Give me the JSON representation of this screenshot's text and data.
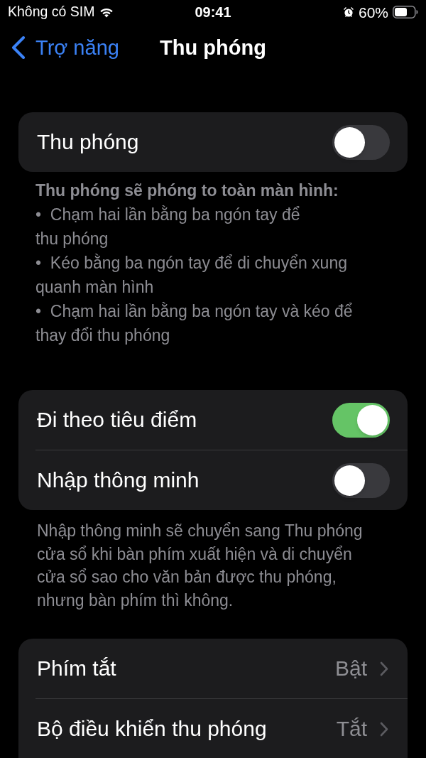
{
  "status_bar": {
    "carrier": "Không có SIM",
    "time": "09:41",
    "battery_percent": "60%"
  },
  "nav": {
    "back_label": "Trợ năng",
    "title": "Thu phóng"
  },
  "sections": [
    {
      "rows": [
        {
          "kind": "switch",
          "label": "Thu phóng",
          "on": false
        }
      ],
      "footer": {
        "heading": "Thu phóng sẽ phóng to toàn màn hình:",
        "bullets": [
          "•  Chạm hai lần bằng ba ngón tay để thu phóng",
          "•  Kéo bằng ba ngón tay để di chuyển xung quanh màn hình",
          "•  Chạm hai lần bằng ba ngón tay và kéo để thay đổi thu phóng"
        ]
      }
    },
    {
      "rows": [
        {
          "kind": "switch",
          "label": "Đi theo tiêu điểm",
          "on": true
        },
        {
          "kind": "switch",
          "label": "Nhập thông minh",
          "on": false
        }
      ],
      "footer": {
        "text": "Nhập thông minh sẽ chuyển sang Thu phóng cửa sổ khi bàn phím xuất hiện và di chuyển cửa sổ sao cho văn bản được thu phóng, nhưng bàn phím thì không."
      }
    },
    {
      "rows": [
        {
          "kind": "link",
          "label": "Phím tắt",
          "value": "Bật"
        },
        {
          "kind": "link",
          "label": "Bộ điều khiển thu phóng",
          "value": "Tắt"
        }
      ]
    }
  ]
}
